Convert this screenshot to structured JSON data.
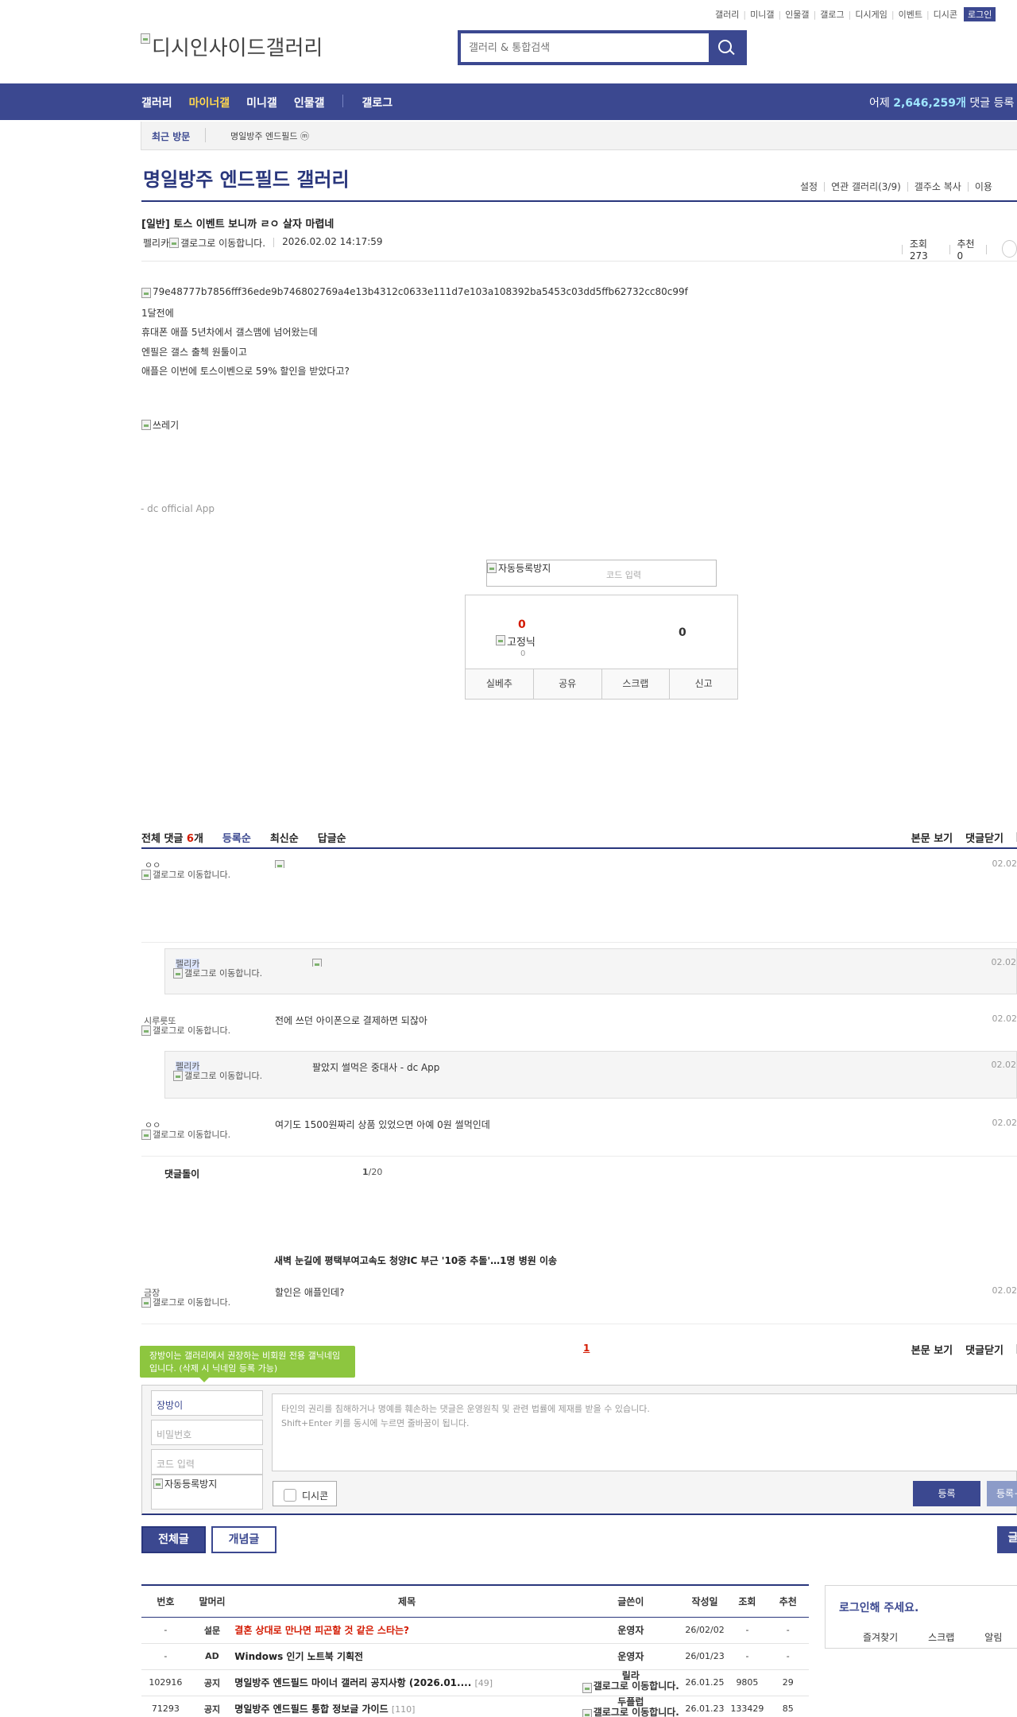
{
  "util_links": [
    "갤러리",
    "미니갤",
    "인물갤",
    "갤로그",
    "디시게임",
    "이벤트",
    "디시콘"
  ],
  "util_login": "로그인",
  "logo_alt": "디시인사이드갤러리",
  "search": {
    "placeholder": "갤러리 & 통합검색"
  },
  "gnb": {
    "items": [
      "갤러리",
      "마이너갤",
      "미니갤",
      "인물갤",
      "갤로그"
    ],
    "count_prefix": "어제 ",
    "count_value": "2,646,259개",
    "count_suffix": " 댓글 등록"
  },
  "recent": {
    "label": "최근 방문",
    "gallery": "명일방주 엔드필드 ⓜ"
  },
  "gallery": {
    "title": "명일방주 엔드필드 갤러리",
    "tools": [
      "설정",
      "연관 갤러리(3/9)",
      "갤주소 복사",
      "이용"
    ]
  },
  "post": {
    "title": "[일반] 토스 이벤트 보니까 ㄹㅇ 살자 마렵네",
    "author": "펠리카",
    "author_img_alt": "갤로그로 이동합니다.",
    "date": "2026.02.02 14:17:59",
    "views": "조회 273",
    "recommend": "추천 0",
    "image_alt": "79e48777b7856fff36ede9b746802769a4e13b4312c0633e111d7e103a108392ba5453c03dd5ffb62732cc80c99f",
    "lines": [
      "1달전에",
      "휴대폰 애플 5년차에서 갤스맴에 넘어왔는데",
      "엔필은 갤스 출첵 원툴이고",
      "애플은 이번에 토스이벤으로 59% 할인을 받았다고?"
    ],
    "image2_alt": "쓰레기",
    "signature": "- dc official App"
  },
  "captcha": {
    "img_alt": "자동등록방지",
    "placeholder": "코드 입력"
  },
  "recommend_box": {
    "up": "0",
    "down": "0",
    "fixed_alt": "고정닉",
    "fixed_count": "0",
    "buttons": [
      "실베추",
      "공유",
      "스크랩",
      "신고"
    ]
  },
  "comments": {
    "total_label": "전체 댓글 ",
    "total_count": "6",
    "total_unit": "개",
    "sorts": [
      "등록순",
      "최신순",
      "답글순"
    ],
    "right": [
      "본문 보기",
      "댓글닫기"
    ],
    "items": [
      {
        "nick": "ㅇㅇ",
        "img_alt": "갤로그로 이동합니다.",
        "text": "",
        "date": "02.02"
      },
      {
        "nick": "펠리카",
        "img_alt": "갤로그로 이동합니다.",
        "text": "",
        "date": "02.02"
      },
      {
        "nick": "시루릇또",
        "img_alt": "갤로그로 이동합니다.",
        "text": "전에 쓰던 아이폰으로 결제하면 되잖아",
        "date": "02.02"
      },
      {
        "nick": "펠리카",
        "img_alt": "갤로그로 이동합니다.",
        "text": "팔았지 썰먹은 중대사 - dc App",
        "date": "02.02"
      },
      {
        "nick": "ㅇㅇ",
        "img_alt": "갤로그로 이동합니다.",
        "text": "여기도 1500원짜리 상품 있었으면 아예 0원 썰먹인데",
        "date": "02.02"
      },
      {
        "nick": "금장",
        "img_alt": "갤로그로 이동합니다.",
        "text": "할인은 애플인데?",
        "date": "02.02"
      }
    ],
    "bot_label": "댓글돌이",
    "bot_page_current": "1",
    "bot_page_total": "/20",
    "bot_news": "새벽 눈길에 평택부여고속도 청양IC 부근 '10중 추돌'…1명 병원 이송",
    "pagination": "1"
  },
  "write": {
    "tip": "장방이는 갤러리에서 권장하는 비회원 전용 갤닉네임입니다. (삭제 시 닉네임 등록 가능)",
    "nick_value": "장방이",
    "password_placeholder": "비밀번호",
    "code_placeholder": "코드 입력",
    "captcha_alt": "자동등록방지",
    "textarea_line1": "타인의 권리를 침해하거나 명예를 훼손하는 댓글은 운영원칙 및 관련 법률에 제재를 받을 수 있습니다.",
    "textarea_line2": "Shift+Enter 키를 동시에 누르면 줄바꿈이 됩니다.",
    "dccon": "디시콘",
    "submit": "등록",
    "submit2": "등록+"
  },
  "list_buttons": {
    "all": "전체글",
    "good": "개념글",
    "write": "글"
  },
  "table": {
    "headers": [
      "번호",
      "말머리",
      "제목",
      "글쓴이",
      "작성일",
      "조회",
      "추천"
    ],
    "rows": [
      {
        "no": "-",
        "head": "설문",
        "title": "결혼 상대로 만나면 피곤할 것 같은 스타는?",
        "cmt": "",
        "writer": "운영자",
        "date": "26/02/02",
        "views": "-",
        "rec": "-"
      },
      {
        "no": "-",
        "head": "AD",
        "title": "Windows 인기 노트북 기획전",
        "cmt": "",
        "writer": "운영자",
        "date": "26/01/23",
        "views": "-",
        "rec": "-"
      },
      {
        "no": "102916",
        "head": "공지",
        "title": "명일방주 엔드필드 마이너 갤러리 공지사항 (2026.01....",
        "cmt": "[49]",
        "writer": "갤로그로 이동합니다.",
        "date": "26.01.25",
        "views": "9805",
        "rec": "29"
      },
      {
        "no": "71293",
        "head": "공지",
        "title": "명일방주 엔드필드 통합 정보글 가이드",
        "cmt": "[110]",
        "writer_top": "두플럽",
        "writer": "갤로그로 이동합니다.",
        "date": "26.01.23",
        "views": "133429",
        "rec": "85"
      }
    ],
    "row3_writer_top": "릴라"
  },
  "login_box": {
    "title": "로그인해 주세요.",
    "links": [
      "즐겨찾기",
      "스크랩",
      "알림"
    ]
  }
}
